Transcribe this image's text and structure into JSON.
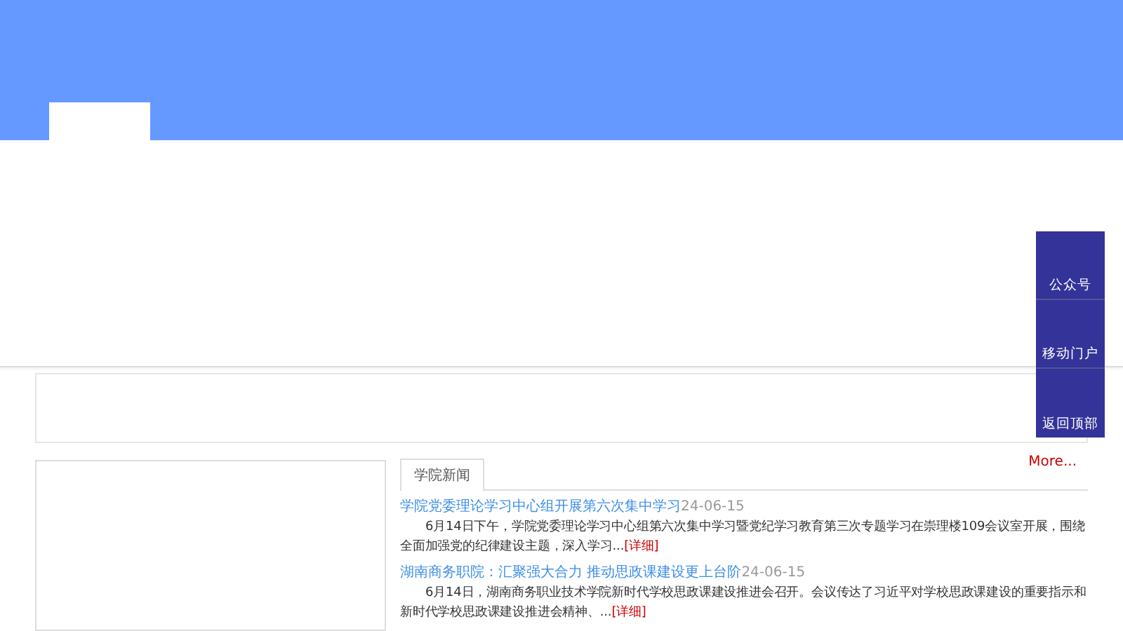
{
  "side_links": [
    {
      "label": "公众号"
    },
    {
      "label": "移动门户"
    },
    {
      "label": "返回顶部"
    }
  ],
  "news": {
    "tabs": [
      {
        "label": "学院新闻",
        "selected": true
      }
    ],
    "more": "More...",
    "items": [
      {
        "title": "学院党委理论学习中心组开展第六次集中学习",
        "date": "24-06-15",
        "summary": "6月14日下午，学院党委理论学习中心组第六次集中学习暨党纪学习教育第三次专题学习在崇理楼109会议室开展，围绕全面加强党的纪律建设主题，深入学习...",
        "detail": "[详细]"
      },
      {
        "title": "湖南商务职院：汇聚强大合力 推动思政课建设更上台阶",
        "date": "24-06-15",
        "summary": "6月14日，湖南商务职业技术学院新时代学校思政课建设推进会召开。会议传达了习近平对学校思政课建设的重要指示和新时代学校思政课建设推进会精神、...",
        "detail": "[详细]"
      }
    ]
  }
}
